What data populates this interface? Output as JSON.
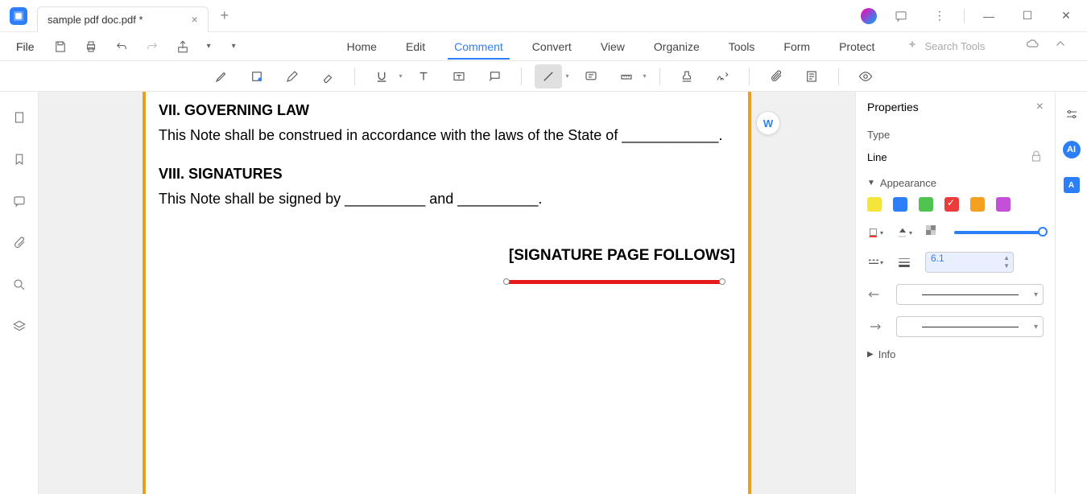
{
  "tab": {
    "title": "sample pdf doc.pdf *"
  },
  "file_menu": "File",
  "menu_tabs": [
    "Home",
    "Edit",
    "Comment",
    "Convert",
    "View",
    "Organize",
    "Tools",
    "Form",
    "Protect"
  ],
  "active_menu_tab": 2,
  "search_placeholder": "Search Tools",
  "document": {
    "section1_title": "VII. GOVERNING LAW",
    "section1_body": "This Note shall be construed in accordance with the laws of the State of ____________.",
    "section2_title": "VIII. SIGNATURES",
    "section2_body": "This Note shall be signed by __________ and __________.",
    "signature_follows": "[SIGNATURE PAGE FOLLOWS]"
  },
  "properties": {
    "title": "Properties",
    "type_label": "Type",
    "type_value": "Line",
    "appearance_label": "Appearance",
    "info_label": "Info",
    "colors": [
      "#f5e53a",
      "#2d7ff9",
      "#4fc24f",
      "#eb3b3b",
      "#f5a020",
      "#c44fd9"
    ],
    "selected_color_index": 3,
    "thickness_value": "6.1"
  }
}
